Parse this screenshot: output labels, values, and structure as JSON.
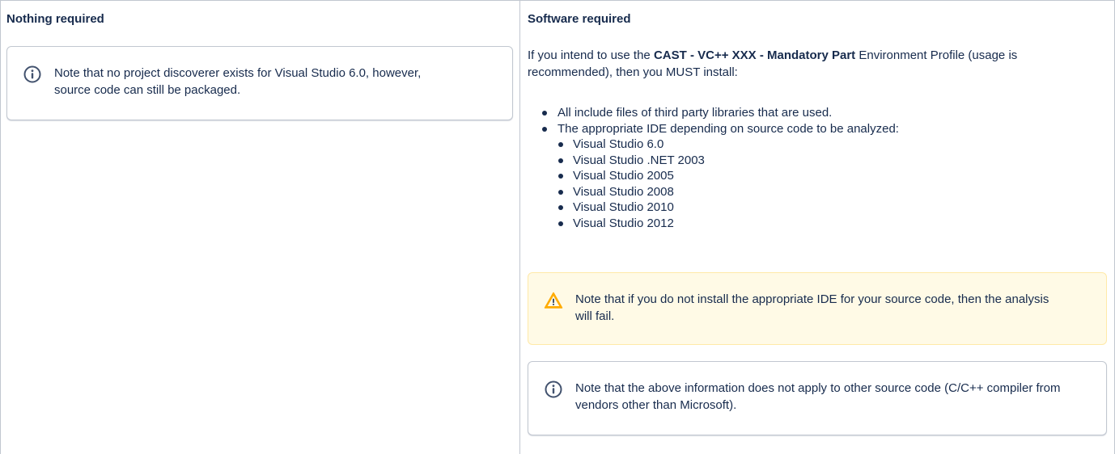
{
  "left_column": {
    "heading": "Nothing required",
    "info_note": "Note that no project discoverer exists for Visual Studio 6.0, however, source code can still be packaged."
  },
  "right_column": {
    "heading": "Software required",
    "intro_prefix": "If you intend to use the ",
    "intro_bold": "CAST - VC++ XXX - Mandatory Part",
    "intro_suffix": " Environment Profile (usage is recommended), then you MUST install:",
    "requirements": [
      "All include files of third party libraries that are used.",
      "The appropriate IDE depending on source code to be analyzed:"
    ],
    "ide_versions": [
      "Visual Studio 6.0",
      "Visual Studio .NET 2003",
      "Visual Studio 2005",
      "Visual Studio 2008",
      "Visual Studio 2010",
      "Visual Studio 2012"
    ],
    "warning_note": "Note that if you do not install the appropriate IDE for your source code, then the analysis will fail.",
    "info_note": "Note that the above information does not apply to other source code (C/C++ compiler from vendors other than Microsoft)."
  },
  "colors": {
    "info_icon": "#42526e",
    "warning_icon_fill": "#ffab00",
    "warning_background": "#fffae6",
    "border": "#c1c7d0"
  },
  "icons": {
    "info": "info-icon",
    "warning": "warning-icon"
  }
}
